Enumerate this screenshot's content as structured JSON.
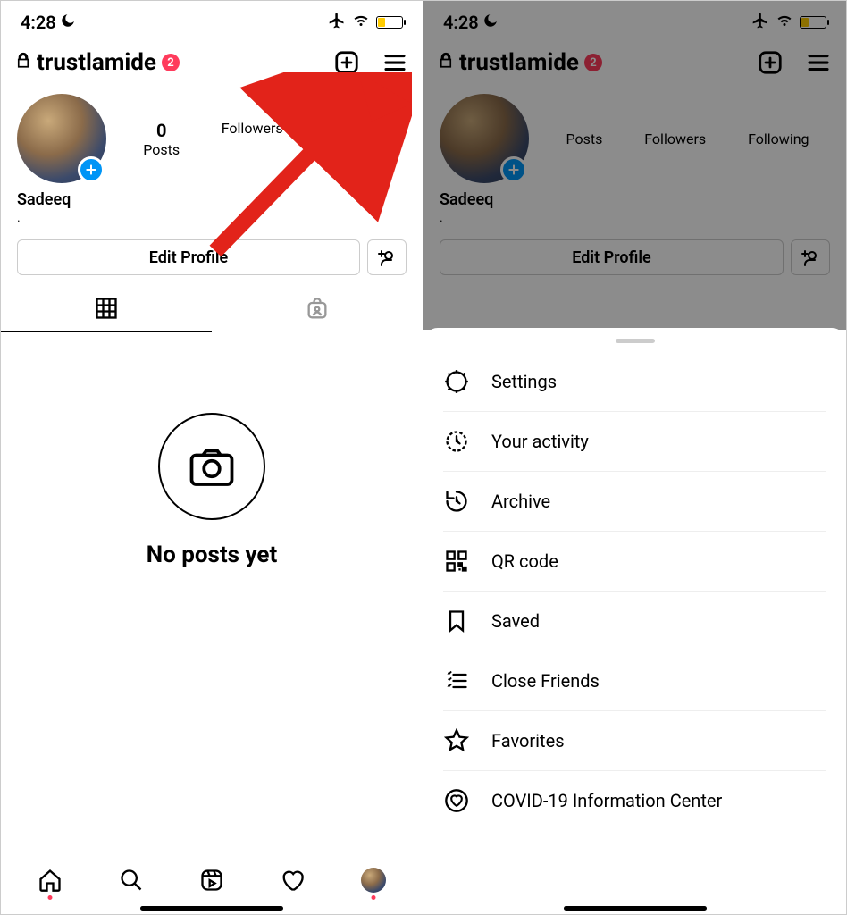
{
  "status": {
    "time": "4:28",
    "moon": "☾",
    "airplane": "✈",
    "wifi": "wifi",
    "battery_pct": 28
  },
  "header": {
    "username": "trustlamide",
    "badge_count": "2"
  },
  "profile": {
    "display_name": "Sadeeq",
    "bio": "."
  },
  "stats": {
    "posts_count": "0",
    "posts_label": "Posts",
    "followers_count": "",
    "followers_label": "Followers",
    "following_count": "",
    "following_label": "Following"
  },
  "buttons": {
    "edit_profile": "Edit Profile"
  },
  "empty": {
    "no_posts": "No posts yet"
  },
  "menu": {
    "items": [
      {
        "label": "Settings",
        "icon": "gear-icon"
      },
      {
        "label": "Your activity",
        "icon": "activity-icon"
      },
      {
        "label": "Archive",
        "icon": "archive-icon"
      },
      {
        "label": "QR code",
        "icon": "qrcode-icon"
      },
      {
        "label": "Saved",
        "icon": "bookmark-icon"
      },
      {
        "label": "Close Friends",
        "icon": "list-icon"
      },
      {
        "label": "Favorites",
        "icon": "star-icon"
      },
      {
        "label": "COVID-19 Information Center",
        "icon": "heart-shield-icon"
      }
    ]
  }
}
